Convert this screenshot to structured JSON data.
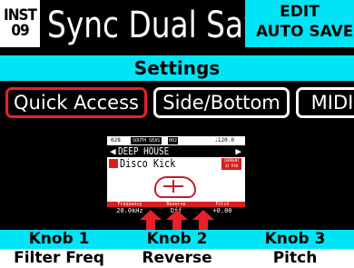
{
  "header": {
    "inst_label": "INST",
    "inst_number": "09",
    "patch_name": "Sync Dual Saw",
    "mode": "EDIT",
    "autosave": "AUTO SAVE"
  },
  "settings_title": "Settings",
  "tabs": [
    {
      "label": "Quick Access",
      "active": true
    },
    {
      "label": "Side/Bottom",
      "active": false
    },
    {
      "label": "MIDI",
      "active": false
    }
  ],
  "preview": {
    "top_id": "028",
    "top_name": "SOUTH SEAS",
    "top_num": "002",
    "bpm": "♩120.0",
    "kit_prev": "◀",
    "kit_name": "DEEP HOUSE",
    "kit_next": "▶",
    "inst_name": "Disco Kick",
    "kit_button": "CURRENT 32 PAD",
    "knob_labels": [
      "Frequency",
      "Reverse",
      "Pitch"
    ],
    "knob_values": [
      "20.0kHz",
      "Off",
      "+0.00"
    ]
  },
  "knobs": [
    {
      "label": "Knob 1",
      "param": "Filter Freq"
    },
    {
      "label": "Knob 2",
      "param": "Reverse"
    },
    {
      "label": "Knob 3",
      "param": "Pitch"
    }
  ],
  "colors": {
    "accent_cyan": "#00e5f5",
    "accent_red": "#e8202a",
    "background": "#000000"
  }
}
